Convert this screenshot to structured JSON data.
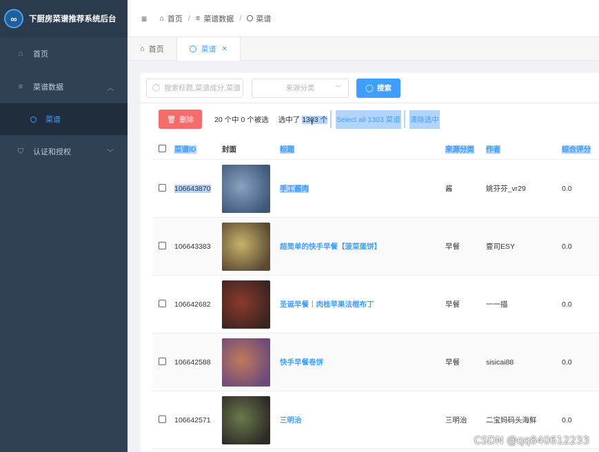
{
  "brand": {
    "title": "下厨房菜谱推荐系统后台",
    "logo_glyph": "∞"
  },
  "sidebar": {
    "items": [
      {
        "label": "首页",
        "icon": "home-icon"
      },
      {
        "label": "菜谱数据",
        "icon": "database-icon",
        "children": [
          {
            "label": "菜谱",
            "icon": "circle-icon"
          }
        ]
      },
      {
        "label": "认证和授权",
        "icon": "shield-icon"
      }
    ]
  },
  "breadcrumb": {
    "items": [
      "首页",
      "菜谱数据",
      "菜谱"
    ]
  },
  "tabs": [
    {
      "label": "首页"
    },
    {
      "label": "菜谱",
      "active": true
    }
  ],
  "filters": {
    "search_placeholder": "搜索标题,菜谱成分,菜谱",
    "category_placeholder": "来源分类",
    "search_label": "搜索"
  },
  "actions": {
    "delete_label": "删除",
    "selection_info": "20 个中 0 个被选",
    "selected_prefix": "选中了",
    "selected_count": "1303 个",
    "select_all_label": "Select all 1303 菜谱",
    "clear_selection_label": "清除选中"
  },
  "table": {
    "columns": [
      "菜谱ID",
      "封面",
      "标题",
      "来源分类",
      "作者",
      "综合评分"
    ],
    "rows": [
      {
        "id": "106643870",
        "title": "手工酱肉",
        "category": "酱",
        "author": "姚芬芬_vr29",
        "score": "0.0",
        "cover_colors": [
          "#8aa2c0",
          "#3f5878"
        ]
      },
      {
        "id": "106643383",
        "title": "超简单的快手早餐【菠菜蛋饼】",
        "category": "早餐",
        "author": "壹司ESY",
        "score": "0.0",
        "cover_colors": [
          "#c9b26a",
          "#5a4a33"
        ]
      },
      {
        "id": "106642682",
        "title": "圣诞早餐｜肉桂苹果法棍布丁",
        "category": "早餐",
        "author": "一一描",
        "score": "0.0",
        "cover_colors": [
          "#8c3a2c",
          "#3a2420"
        ]
      },
      {
        "id": "106642588",
        "title": "快手早餐卷饼",
        "category": "早餐",
        "author": "sisicai88",
        "score": "0.0",
        "cover_colors": [
          "#c07a58",
          "#6c4a7c"
        ]
      },
      {
        "id": "106642571",
        "title": "三明治",
        "category": "三明治",
        "author": "二宝妈码头海鲜",
        "score": "0.0",
        "cover_colors": [
          "#6a7a4c",
          "#2e2a26"
        ]
      }
    ]
  },
  "watermark": "CSDN @qq840612233",
  "colors": {
    "primary": "#409eff",
    "danger": "#f56c6c",
    "sidebar": "#304156"
  }
}
